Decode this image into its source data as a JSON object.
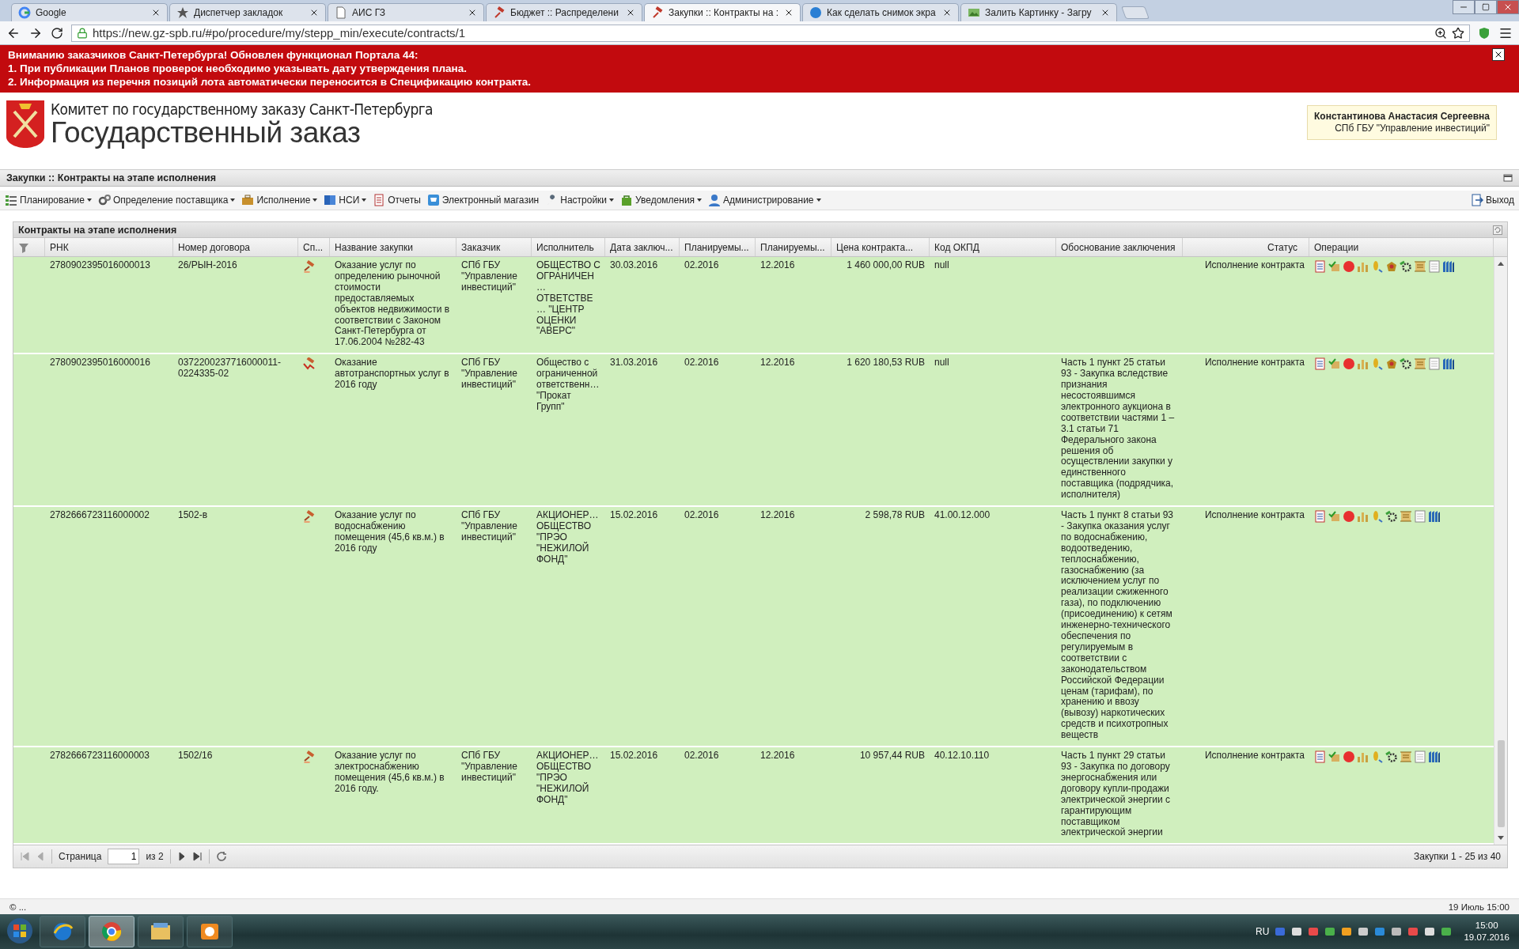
{
  "browser": {
    "tabs": [
      {
        "title": "Google",
        "selected": false
      },
      {
        "title": "Диспетчер закладок",
        "selected": false
      },
      {
        "title": "АИС ГЗ",
        "selected": false
      },
      {
        "title": "Бюджет :: Распределени",
        "selected": false
      },
      {
        "title": "Закупки :: Контракты на :",
        "selected": true
      },
      {
        "title": "Как сделать снимок экра",
        "selected": false
      },
      {
        "title": "Залить Картинку - Загру",
        "selected": false
      }
    ],
    "url": "https://new.gz-spb.ru/#po/procedure/my/stepp_min/execute/contracts/1"
  },
  "banner": {
    "lines": [
      "Вниманию заказчиков Санкт-Петербурга! Обновлен функционал Портала 44:",
      "1. При публикации Планов проверок необходимо указывать дату утверждения плана.",
      "2. Информация из перечня позиций лота автоматически переносится в Спецификацию контракта."
    ]
  },
  "header": {
    "org": "Комитет по государственному заказу Санкт-Петербурга",
    "title": "Государственный заказ",
    "user": {
      "name": "Константинова Анастасия Сергеевна",
      "org": "СПб ГБУ \"Управление инвестиций\""
    }
  },
  "page_title": "Закупки :: Контракты на этапе исполнения",
  "menu": [
    {
      "label": "Планирование",
      "has_menu": true
    },
    {
      "label": "Определение поставщика",
      "has_menu": true
    },
    {
      "label": "Исполнение",
      "has_menu": true
    },
    {
      "label": "НСИ",
      "has_menu": true
    },
    {
      "label": "Отчеты",
      "has_menu": false
    },
    {
      "label": "Электронный магазин",
      "has_menu": false
    },
    {
      "label": "Настройки",
      "has_menu": true
    },
    {
      "label": "Уведомления",
      "has_menu": true
    },
    {
      "label": "Администрирование",
      "has_menu": true
    }
  ],
  "exit": "Выход",
  "panel": {
    "title": "Контракты на этапе исполнения",
    "columns": [
      "РНК",
      "Номер договора",
      "Сп...",
      "Название закупки",
      "Заказчик",
      "Исполнитель",
      "Дата заключ...",
      "Планируемы...",
      "Планируемы...",
      "Цена контракта...",
      "Код ОКПД",
      "Обоснование заключения",
      "Статус",
      "Операции"
    ],
    "rows": [
      {
        "rnk": "2780902395016000013",
        "number": "26/РЫН-2016",
        "method": {
          "kind": "gavel"
        },
        "name": "Оказание услуг по определению рыночной стоимости предоставляемых объектов недвижимости в соответствии с Законом Санкт-Петербурга от 17.06.2004 №282-43",
        "customer": "СПб ГБУ \"Управление инвестиций\"",
        "supplier": "ОБЩЕСТВО С ОГРАНИЧЕН… ОТВЕТСТВЕ… \"ЦЕНТР ОЦЕНКИ \"АВЕРС\"",
        "date": "30.03.2016",
        "plan_start": "02.2016",
        "plan_end": "12.2016",
        "price": "1 460 000,00 RUB",
        "okpd": "null",
        "status": "Исполнение контракта",
        "emblem_action": true
      },
      {
        "rnk": "2780902395016000016",
        "number": "0372200237716000011-0224335-02",
        "method": {
          "kind": "gavel-arrow"
        },
        "name": "Оказание автотранспортных услуг в 2016 году",
        "customer": "СПб ГБУ \"Управление инвестиций\"",
        "supplier": "Общество с ограниченной ответственн… \"Прокат Групп\"",
        "date": "31.03.2016",
        "plan_start": "02.2016",
        "plan_end": "12.2016",
        "price": "1 620 180,53 RUB",
        "okpd": "null",
        "basis": "Часть 1 пункт 25 статьи 93 - Закупка вследствие признания несостоявшимся электронного аукциона в соответствии частями 1 – 3.1 статьи 71 Федерального закона решения об осуществлении закупки у единственного поставщика (подрядчика, исполнителя)",
        "status": "Исполнение контракта",
        "emblem_action": true
      },
      {
        "rnk": "2782666723116000002",
        "number": "1502-в",
        "method": {
          "kind": "gavel"
        },
        "name": "Оказание услуг по водоснабжению помещения (45,6 кв.м.) в 2016 году",
        "customer": "СПб ГБУ \"Управление инвестиций\"",
        "supplier": "АКЦИОНЕР… ОБЩЕСТВО \"ПРЭО \"НЕЖИЛОЙ ФОНД\"",
        "date": "15.02.2016",
        "plan_start": "02.2016",
        "plan_end": "12.2016",
        "price": "2 598,78 RUB",
        "okpd": "41.00.12.000",
        "basis": "Часть 1 пункт 8 статьи 93 - Закупка оказания услуг по водоснабжению, водоотведению, теплоснабжению, газоснабжению (за исключением услуг по реализации сжиженного газа), по подключению (присоединению) к сетям инженерно-технического обеспечения по регулируемым в соответствии с законодательством Российской Федерации ценам (тарифам), по хранению и ввозу (вывозу) наркотических средств и психотропных веществ",
        "status": "Исполнение контракта",
        "emblem_action": false
      },
      {
        "rnk": "2782666723116000003",
        "number": "1502/16",
        "method": {
          "kind": "gavel"
        },
        "name": "Оказание услуг по электроснабжению помещения (45,6 кв.м.) в 2016 году.",
        "customer": "СПб ГБУ \"Управление инвестиций\"",
        "supplier": "АКЦИОНЕР… ОБЩЕСТВО \"ПРЭО \"НЕЖИЛОЙ ФОНД\"",
        "date": "15.02.2016",
        "plan_start": "02.2016",
        "plan_end": "12.2016",
        "price": "10 957,44 RUB",
        "okpd": "40.12.10.110",
        "basis": "Часть 1 пункт 29 статьи 93 - Закупка по договору энергоснабжения или договору купли-продажи электрической энергии с гарантирующим поставщиком электрической энергии",
        "status": "Исполнение контракта",
        "emblem_action": false
      }
    ],
    "pager": {
      "page_label": "Страница",
      "page": "1",
      "of": "из 2",
      "summary": "Закупки 1 - 25 из 40"
    }
  },
  "status_bar": {
    "left": "© ...",
    "right": "19 Июль 15:00"
  },
  "taskbar": {
    "apps": [
      {
        "selected": false
      },
      {
        "selected": false
      },
      {
        "selected": true
      },
      {
        "selected": false
      },
      {
        "selected": false
      }
    ],
    "lang": "RU",
    "time": "15:00",
    "date": "19.07.2016"
  }
}
